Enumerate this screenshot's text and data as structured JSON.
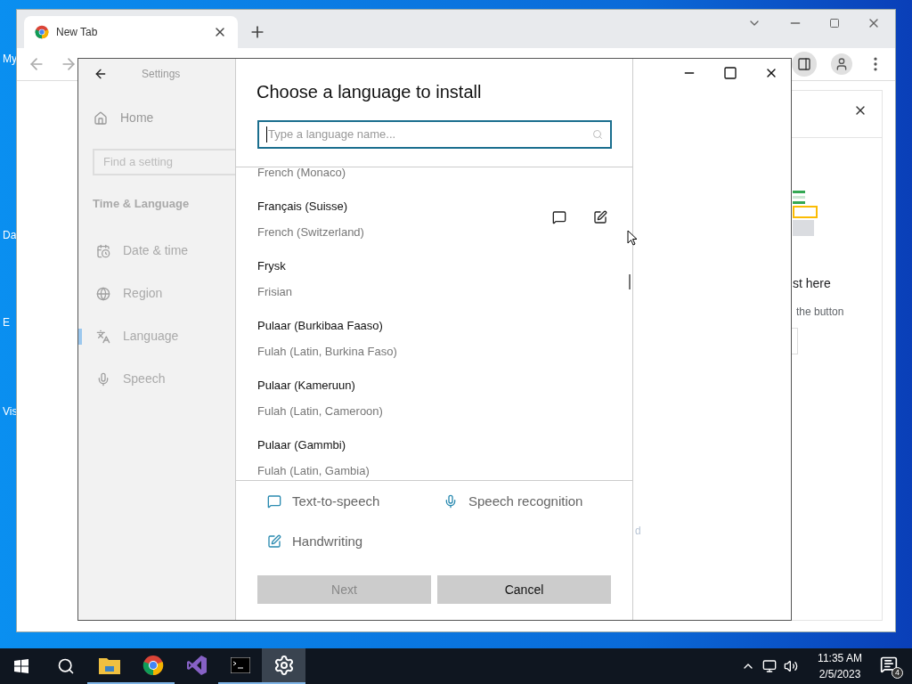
{
  "desktop": {
    "icon_labels": [
      "My",
      "Da",
      "E",
      "Vis"
    ]
  },
  "browser": {
    "tab_title": "New Tab",
    "side_panel": {
      "heading": "st here",
      "text": "the button",
      "footer": "d"
    }
  },
  "settings": {
    "title": "Settings",
    "home": "Home",
    "search_placeholder": "Find a setting",
    "section": "Time & Language",
    "nav": [
      {
        "kind": "date",
        "label": "Date & time",
        "selected": false
      },
      {
        "kind": "region",
        "label": "Region",
        "selected": false
      },
      {
        "kind": "language",
        "label": "Language",
        "selected": true
      },
      {
        "kind": "speech",
        "label": "Speech",
        "selected": false
      }
    ]
  },
  "dialog": {
    "title": "Choose a language to install",
    "search_placeholder": "Type a language name...",
    "languages": [
      {
        "english": "French (Monaco)"
      },
      {
        "name": "Français (Suisse)",
        "english": "French (Switzerland)",
        "features": [
          {
            "kind": "text-to-speech"
          },
          {
            "kind": "handwriting"
          }
        ]
      },
      {
        "name": "Frysk",
        "english": "Frisian"
      },
      {
        "name": "Pulaar (Burkibaa Faaso)",
        "english": "Fulah (Latin, Burkina Faso)"
      },
      {
        "name": "Pulaar (Kameruun)",
        "english": "Fulah (Latin, Cameroon)"
      },
      {
        "name": "Pulaar (Gammbi)",
        "english": "Fulah (Latin, Gambia)"
      }
    ],
    "legend": [
      {
        "kind": "text-to-speech",
        "label": "Text-to-speech"
      },
      {
        "kind": "speech-recognition",
        "label": "Speech recognition"
      },
      {
        "kind": "handwriting",
        "label": "Handwriting"
      }
    ],
    "buttons": [
      {
        "label": "Next",
        "disabled": true
      },
      {
        "label": "Cancel",
        "disabled": false
      }
    ]
  },
  "taskbar": {
    "apps": [
      {
        "kind": "explorer",
        "running": true,
        "selected": false
      },
      {
        "kind": "chrome",
        "running": true,
        "selected": false
      },
      {
        "kind": "vs",
        "running": false,
        "selected": false
      },
      {
        "kind": "terminal",
        "running": true,
        "selected": false
      },
      {
        "kind": "settings",
        "running": true,
        "selected": true
      }
    ],
    "time": "11:35 AM",
    "date": "2/5/2023",
    "notifications": "4"
  }
}
